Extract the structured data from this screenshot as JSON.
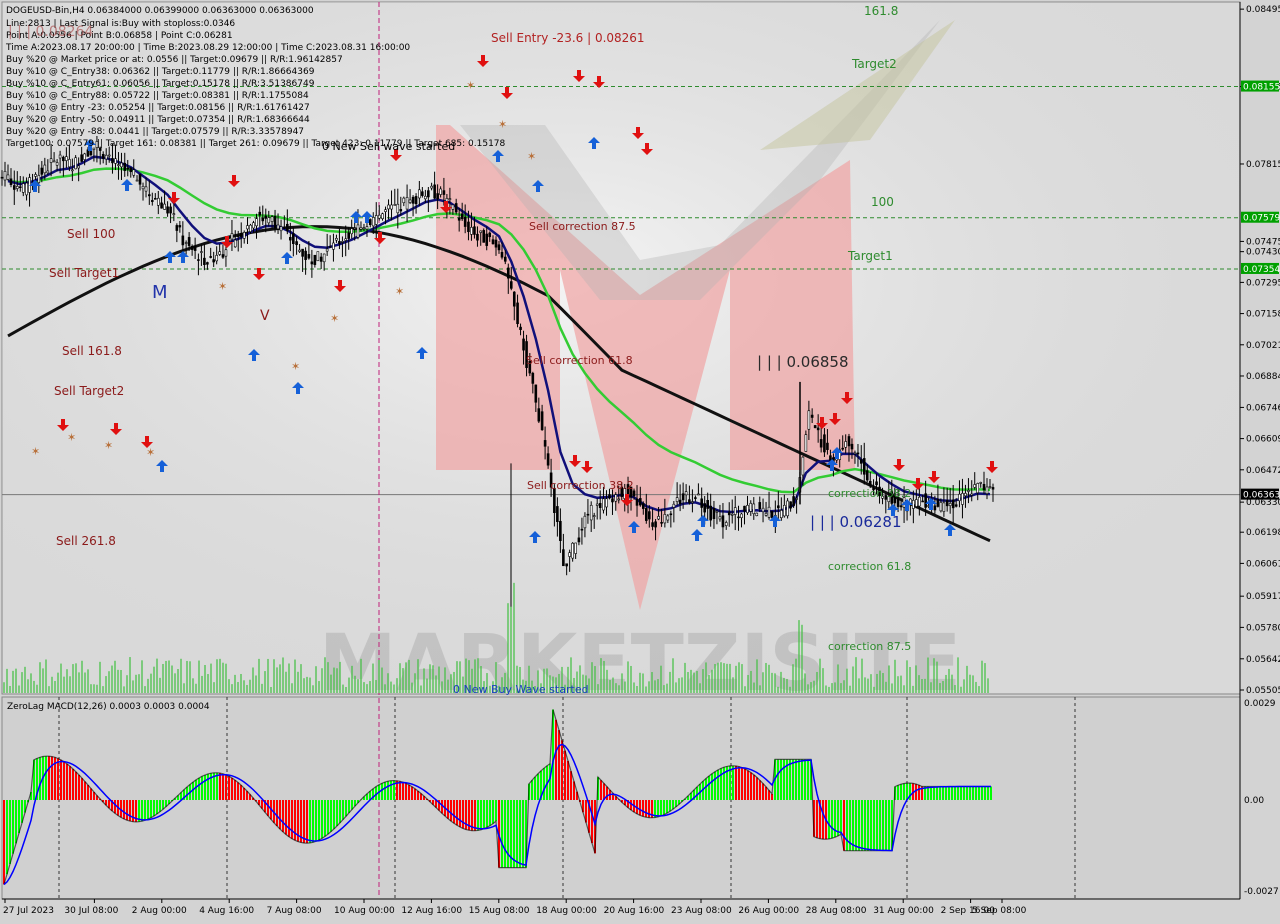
{
  "window": {
    "symbol_header": "DOGEUSD-Bin,H4  0.06384000 0.06399000 0.06363000 0.06363000"
  },
  "info_lines": [
    "Line:2813  | Last Signal is:Buy with stoploss:0.0346",
    "Point A:0.0556 | Point B:0.06858 | Point C:0.06281",
    "Time A:2023.08.17 20:00:00 | Time B:2023.08.29 12:00:00 | Time C:2023.08.31 16:00:00",
    "Buy %20 @ Market price or at: 0.0556 || Target:0.09679 || R/R:1.96142857",
    "Buy %10 @ C_Entry38: 0.06362 || Target:0.11779 || R/R:1.86664369",
    "Buy %10 @ C_Entry61: 0.06056 || Target:0.15178 || R/R:3.51386749",
    "Buy %10 @ C_Entry88: 0.05722 || Target:0.08381 || R/R:1.1755084",
    "Buy %10 @ Entry -23: 0.05254 || Target:0.08156 || R/R:1.61761427",
    "Buy %20 @ Entry -50: 0.04911 || Target:0.07354 || R/R:1.68366644",
    "Buy %20 @ Entry -88: 0.0441 || Target:0.07579 || R/R:3.33578947",
    "Target100: 0.07579 || Target 161: 0.08381 || Target 261: 0.09679 || Target 423: 0.11779 || Target 685: 0.15178"
  ],
  "header_overlay": "| | | 0.08264",
  "watermark": "MARKETZISITE",
  "chart_labels": {
    "sell_entry": "Sell Entry -23.6 | 0.08261",
    "sell_corr_875": "Sell correction 87.5",
    "sell_corr_618": "Sell correction 61.8",
    "sell_corr_382": "Sell correction 38.2",
    "sell_100": "Sell 100",
    "sell_target1": "Sell Target1",
    "sell_1618": "Sell 161.8",
    "sell_target2": "Sell Target2",
    "sell_2618": "Sell  261.8",
    "lvl_1618": "161.8",
    "target2": "Target2",
    "lvl_100": "100",
    "target1": "Target1",
    "point_b": "| | | 0.06858",
    "point_c": "| | | 0.06281",
    "corr_382": "correction 38.2",
    "corr_618": "correction 61.8",
    "corr_875": "correction 87.5",
    "new_sell_wave": "0 New Sell wave started",
    "new_buy_wave": "0 New Buy Wave started",
    "m_letter": "M",
    "v_letter": "V"
  },
  "macd": {
    "title": "ZeroLag MACD(12,26) 0.0003 0.0003 0.0004",
    "ticks": [
      "0.0029",
      "0.00",
      "-0.0027"
    ],
    "colors": {
      "positive": "#00ff00",
      "negative": "#ff0000",
      "main_line": "#000000",
      "signal_line": "#0000ff"
    }
  },
  "chart_data": {
    "type": "candlestick",
    "symbol": "DOGEUSD-Bin",
    "timeframe": "H4",
    "ylim": [
      0.05505,
      0.08575
    ],
    "price_ticks": [
      "0.08575",
      "0.08251",
      "0.07910",
      "0.07585",
      "0.07260",
      "0.06926",
      "0.06601",
      "0.06276",
      "0.05950",
      "0.05626",
      "0.05300",
      "0.04974",
      "0.04649",
      "0.04324",
      "0.04000",
      "0.03676",
      "0.03350",
      "0.03025",
      "0.02700",
      "0.02375",
      "0.02050",
      "0.01725",
      "0.01400",
      "0.01070",
      "0.00745",
      "0.00420",
      "0.00095",
      "0.05505"
    ],
    "price_axis": [
      "0.08575",
      "0.08251",
      "0.07910",
      "0.07585",
      "0.07260",
      "0.06926",
      "0.06601",
      "0.06276",
      "0.05950",
      "0.05626",
      "0.05300",
      "0.04974",
      "0.04649",
      "0.04324",
      "0.04000",
      "0.03676",
      "0.03350",
      "0.03025",
      "0.02700",
      "0.02375",
      "0.02050"
    ],
    "axis_prices": [
      "0.08251",
      "0.07910",
      "0.07585",
      "0.07260",
      "0.06926",
      "0.06601"
    ],
    "visible_price_ticks": [
      "0.08575",
      "0.08251",
      "0.07910",
      "0.07585",
      "0.07260",
      "0.06926",
      "0.06601",
      "0.06276",
      "0.05950",
      "0.05626",
      "0.05300",
      "0.04974",
      "0.04649",
      "0.04324",
      "0.04000",
      "0.03676",
      "0.03350",
      "0.03025",
      "0.02700",
      "0.02375",
      "0.02050",
      "0.01725",
      "0.01400",
      "0.01070",
      "0.00745",
      "0.00420",
      "0.00095"
    ],
    "y_ticks": [
      "0.08495",
      "0.08155",
      "0.07815",
      "0.07475",
      "0.07430",
      "0.07295",
      "0.07158",
      "0.07021",
      "0.06884",
      "0.06746",
      "0.06609",
      "0.06472",
      "0.06330",
      "0.06198",
      "0.06061",
      "0.05917",
      "0.05780",
      "0.05642",
      "0.05505"
    ],
    "highlighted_prices": [
      {
        "value": "0.08155",
        "color": "#00a000"
      },
      {
        "value": "0.07579",
        "color": "#00a000"
      },
      {
        "value": "0.07354",
        "color": "#00a000"
      },
      {
        "value": "0.06363",
        "color": "#000000"
      }
    ],
    "x_ticks": [
      "27 Jul 2023",
      "30 Jul 08:00",
      "2 Aug 00:00",
      "4 Aug 16:00",
      "7 Aug 08:00",
      "10 Aug 00:00",
      "12 Aug 16:00",
      "15 Aug 08:00",
      "18 Aug 00:00",
      "20 Aug 16:00",
      "23 Aug 08:00",
      "26 Aug 00:00",
      "28 Aug 08:00",
      "31 Aug 00:00",
      "2 Sep 16:00",
      "5 Sep 08:00"
    ],
    "levels": {
      "target2": 0.08155,
      "level_100": 0.07579,
      "target1": 0.07354,
      "current": 0.06363,
      "point_b": 0.06858,
      "point_c": 0.06281,
      "point_a": 0.0556
    },
    "series": [
      {
        "name": "close",
        "values": [
          0.0774,
          0.077,
          0.0776,
          0.078,
          0.0784,
          0.0781,
          0.0786,
          0.079,
          0.0783,
          0.0779,
          0.0776,
          0.0769,
          0.0765,
          0.076,
          0.0748,
          0.0742,
          0.0739,
          0.0742,
          0.0748,
          0.0753,
          0.0758,
          0.0758,
          0.0754,
          0.0747,
          0.0741,
          0.074,
          0.0744,
          0.0749,
          0.0752,
          0.0756,
          0.0759,
          0.0762,
          0.0764,
          0.0767,
          0.077,
          0.0768,
          0.0762,
          0.0754,
          0.075,
          0.0748,
          0.0742,
          0.0718,
          0.0695,
          0.067,
          0.064,
          0.0605,
          0.0615,
          0.0628,
          0.0632,
          0.0636,
          0.0638,
          0.0633,
          0.0624,
          0.0626,
          0.0632,
          0.0636,
          0.0634,
          0.0628,
          0.0625,
          0.0628,
          0.063,
          0.063,
          0.0628,
          0.063,
          0.0636,
          0.0672,
          0.066,
          0.0652,
          0.066,
          0.0654,
          0.064,
          0.0636,
          0.0634,
          0.0632,
          0.0634,
          0.0633,
          0.0631,
          0.0633,
          0.0638,
          0.064,
          0.0636
        ]
      }
    ]
  }
}
